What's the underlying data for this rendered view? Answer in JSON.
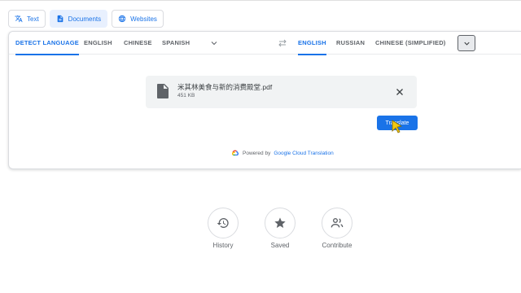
{
  "mode_tabs": [
    {
      "label": "Text",
      "icon": "translate-icon"
    },
    {
      "label": "Documents",
      "icon": "document-icon",
      "active": true
    },
    {
      "label": "Websites",
      "icon": "globe-icon"
    }
  ],
  "source_langs": [
    "DETECT LANGUAGE",
    "ENGLISH",
    "CHINESE",
    "SPANISH"
  ],
  "target_langs": [
    "ENGLISH",
    "RUSSIAN",
    "CHINESE (SIMPLIFIED)"
  ],
  "file": {
    "name": "米其林美食与新的消费殿堂.pdf",
    "size": "451 KB"
  },
  "translate_label": "Translate",
  "powered": {
    "prefix": "Powered by",
    "link": "Google Cloud Translation"
  },
  "actions": [
    {
      "label": "History",
      "icon": "history-icon"
    },
    {
      "label": "Saved",
      "icon": "star-icon"
    },
    {
      "label": "Contribute",
      "icon": "contribute-icon"
    }
  ],
  "colors": {
    "accent": "#1a73e8",
    "border": "#dadce0",
    "muted": "#5f6368"
  }
}
